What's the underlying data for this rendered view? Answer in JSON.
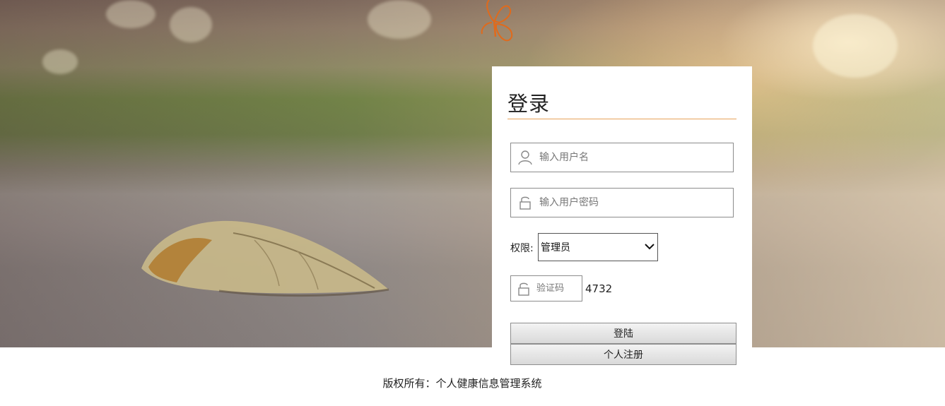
{
  "login": {
    "title": "登录",
    "username_placeholder": "输入用户名",
    "password_placeholder": "输入用户密码",
    "role_label": "权限:",
    "role_selected": "管理员",
    "captcha_placeholder": "验证码",
    "captcha_code": "4732",
    "login_button": "登陆",
    "register_button": "个人注册"
  },
  "footer": {
    "copyright": "版权所有：个人健康信息管理系统"
  },
  "colors": {
    "accent": "#e8a25a",
    "butterfly": "#e06a1c"
  },
  "icons": {
    "username": "user-icon",
    "password": "lock-icon",
    "captcha": "lock-icon",
    "select": "chevron-down-icon"
  }
}
